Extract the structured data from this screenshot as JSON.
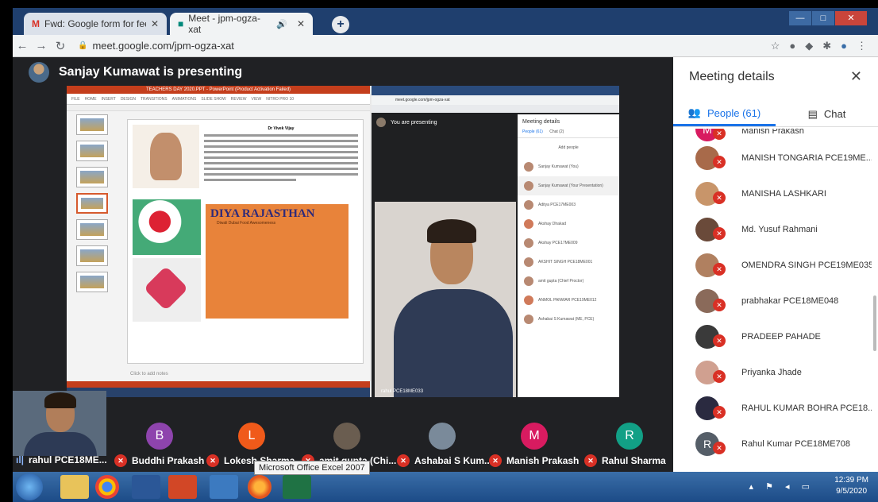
{
  "browser": {
    "tabs": [
      {
        "title": "Fwd: Google form for feedback &"
      },
      {
        "title": "Meet - jpm-ogza-xat"
      }
    ],
    "url": "meet.google.com/jpm-ogza-xat"
  },
  "meet": {
    "presenting_banner": "Sanjay Kumawat is presenting",
    "presentation": {
      "ppt_title": "TEACHERS DAY 2020.PPT - PowerPoint (Product Activation Failed)",
      "ribbon_tabs": [
        "FILE",
        "HOME",
        "INSERT",
        "DESIGN",
        "TRANSITIONS",
        "ANIMATIONS",
        "SLIDE SHOW",
        "REVIEW",
        "VIEW",
        "NITRO PRO 10"
      ],
      "slide_heading": "Dr Vivek Vijay",
      "slide_banner_title": "DIYA RAJASTHAN",
      "slide_banner_sub": "Diwali Dubai Food Awesomeness",
      "notes_placeholder": "Click to add notes",
      "inner_you_presenting": "You are presenting",
      "inner_panel_title": "Meeting details",
      "inner_people_tab": "People (61)",
      "inner_chat_tab": "Chat (2)",
      "inner_add_people": "Add people",
      "inner_participants": [
        "Sanjay Kumawat (You)",
        "Sanjay Kumawat (Your Presentation)",
        "Aditya PCE17ME003",
        "Akshay Dhakad",
        "Akshay PCE17ME009",
        "AKSHIT SINGH PCE18ME001",
        "amit gupta (Chief Proctor)",
        "ANMOL PANWAR PCE19ME012",
        "Ashabai S Kumawat (ME, PCE)"
      ],
      "inner_name_tag": "rahul PCE18ME033"
    },
    "self_tile": {
      "name": "rahul PCE18ME..."
    },
    "tiles": [
      {
        "initial": "B",
        "name": "Buddhi Prakash",
        "color": "#8e44ad"
      },
      {
        "initial": "L",
        "name": "Lokesh Sharma",
        "color": "#f05a1a"
      },
      {
        "initial": "",
        "name": "amit gupta (Chi...",
        "color": "#6a5d50"
      },
      {
        "initial": "",
        "name": "Ashabai S Kum...",
        "color": "#7a8a9a"
      },
      {
        "initial": "M",
        "name": "Manish Prakash",
        "color": "#d81b60"
      },
      {
        "initial": "R",
        "name": "Rahul Sharma",
        "color": "#12a086"
      }
    ]
  },
  "panel": {
    "title": "Meeting details",
    "people_tab": "People (61)",
    "chat_tab": "Chat",
    "people": [
      {
        "initial": "M",
        "name": "Manish Prakash",
        "color": "#d81b60"
      },
      {
        "initial": "",
        "name": "MANISH TONGARIA PCE19ME...",
        "color": "#a86a4a"
      },
      {
        "initial": "",
        "name": "MANISHA LASHKARI",
        "color": "#c8956a"
      },
      {
        "initial": "",
        "name": "Md. Yusuf Rahmani",
        "color": "#6a4a3a"
      },
      {
        "initial": "",
        "name": "OMENDRA SINGH PCE19ME035",
        "color": "#b08060"
      },
      {
        "initial": "",
        "name": "prabhakar PCE18ME048",
        "color": "#8a6a5a"
      },
      {
        "initial": "",
        "name": "PRADEEP PAHADE",
        "color": "#3a3a3a"
      },
      {
        "initial": "",
        "name": "Priyanka Jhade",
        "color": "#d0a090"
      },
      {
        "initial": "",
        "name": "RAHUL KUMAR BOHRA PCE18...",
        "color": "#2a2a40"
      },
      {
        "initial": "R",
        "name": "Rahul Kumar PCE18ME708",
        "color": "#555e68"
      }
    ]
  },
  "taskbar": {
    "tooltip": "Microsoft Office Excel 2007",
    "time": "12:39 PM",
    "date": "9/5/2020"
  }
}
